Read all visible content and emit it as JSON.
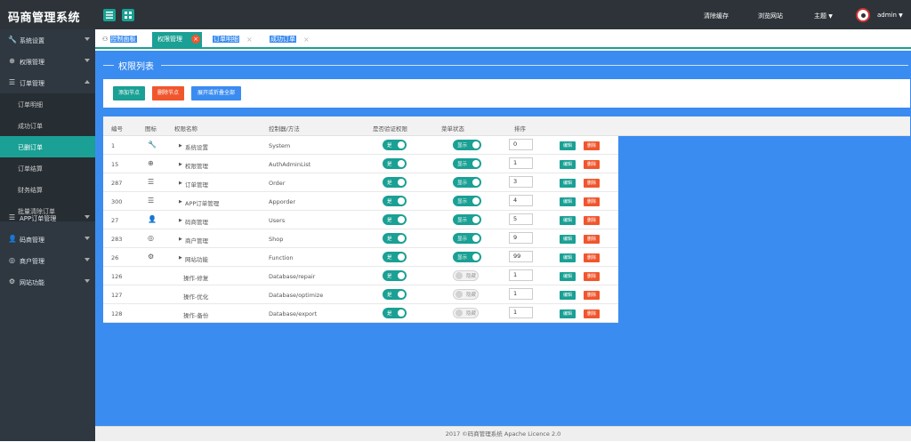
{
  "app": {
    "brand": "码商管理系统"
  },
  "topbar": {
    "clear_cache": "清除缓存",
    "browse_site": "浏览网站",
    "theme": "主题",
    "username": "admin"
  },
  "sidebar": {
    "items": [
      {
        "label": "系统设置",
        "icon": "wrench-icon"
      },
      {
        "label": "权限管理",
        "icon": "globe-icon"
      },
      {
        "label": "订单管理",
        "icon": "list-icon"
      },
      {
        "label": "APP订单管理",
        "icon": "list-icon"
      },
      {
        "label": "码商管理",
        "icon": "user-icon"
      },
      {
        "label": "商户管理",
        "icon": "shop-icon"
      },
      {
        "label": "网站功能",
        "icon": "gear-icon"
      }
    ],
    "subitems": [
      "订单明细",
      "成功订单",
      "已删订单",
      "订单结算",
      "财务结算",
      "批量清除订单"
    ]
  },
  "tabs": [
    {
      "label": "控制面板"
    },
    {
      "label": "权限管理"
    },
    {
      "label": "订单明细"
    },
    {
      "label": "成功订单"
    }
  ],
  "page": {
    "title": "权限列表"
  },
  "actions": {
    "add": "添加节点",
    "delete": "删除节点",
    "toggle": "展开或折叠全部"
  },
  "table": {
    "headers": [
      "编号",
      "图标",
      "权限名称",
      "控制器/方法",
      "是否验证权限",
      "菜单状态",
      "排序"
    ],
    "rows": [
      {
        "id": "1",
        "icon": "wrench-icon",
        "name": "系统设置",
        "ctrl": "System",
        "auth": "是",
        "menu": "显示",
        "menu_on": true,
        "sort": "0",
        "child": false
      },
      {
        "id": "15",
        "icon": "globe-icon",
        "name": "权限管理",
        "ctrl": "AuthAdminList",
        "auth": "是",
        "menu": "显示",
        "menu_on": true,
        "sort": "1",
        "child": false
      },
      {
        "id": "287",
        "icon": "list-icon",
        "name": "订单管理",
        "ctrl": "Order",
        "auth": "是",
        "menu": "显示",
        "menu_on": true,
        "sort": "3",
        "child": false
      },
      {
        "id": "300",
        "icon": "list-icon",
        "name": "APP订单管理",
        "ctrl": "Apporder",
        "auth": "是",
        "menu": "显示",
        "menu_on": true,
        "sort": "4",
        "child": false
      },
      {
        "id": "27",
        "icon": "user-icon",
        "name": "码商管理",
        "ctrl": "Users",
        "auth": "是",
        "menu": "显示",
        "menu_on": true,
        "sort": "5",
        "child": false
      },
      {
        "id": "283",
        "icon": "shop-icon",
        "name": "商户管理",
        "ctrl": "Shop",
        "auth": "是",
        "menu": "显示",
        "menu_on": true,
        "sort": "9",
        "child": false
      },
      {
        "id": "26",
        "icon": "gear-icon",
        "name": "网站功能",
        "ctrl": "Function",
        "auth": "是",
        "menu": "显示",
        "menu_on": true,
        "sort": "99",
        "child": false
      },
      {
        "id": "126",
        "icon": "",
        "name": "操作-修复",
        "ctrl": "Database/repair",
        "auth": "是",
        "menu": "隐藏",
        "menu_on": false,
        "sort": "1",
        "child": true
      },
      {
        "id": "127",
        "icon": "",
        "name": "操作-优化",
        "ctrl": "Database/optimize",
        "auth": "是",
        "menu": "隐藏",
        "menu_on": false,
        "sort": "1",
        "child": true
      },
      {
        "id": "128",
        "icon": "",
        "name": "操作-备份",
        "ctrl": "Database/export",
        "auth": "是",
        "menu": "隐藏",
        "menu_on": false,
        "sort": "1",
        "child": true
      }
    ],
    "edit_label": "编辑",
    "delete_label": "删除"
  },
  "footer": {
    "text": "2017 ©码商管理系统 Apache Licence 2.0"
  },
  "colors": {
    "topbar": "#2d3339",
    "sidebar": "#2f3740",
    "accent": "#1aa094",
    "blue": "#3b8cf0",
    "danger": "#f0562d"
  }
}
